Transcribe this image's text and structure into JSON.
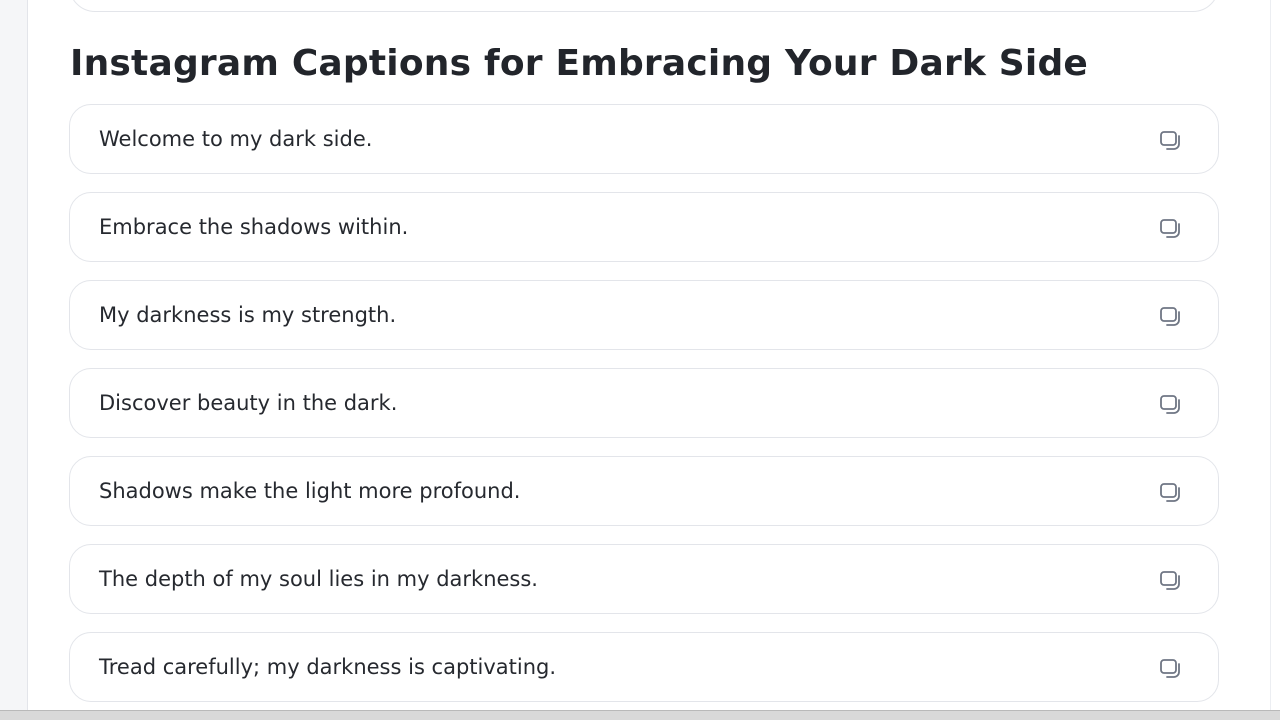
{
  "section": {
    "title": "Instagram Captions for Embracing Your Dark Side"
  },
  "captions": [
    {
      "text": "Welcome to my dark side.",
      "icon": "copy-icon"
    },
    {
      "text": "Embrace the shadows within.",
      "icon": "copy-icon"
    },
    {
      "text": "My darkness is my strength.",
      "icon": "copy-icon"
    },
    {
      "text": "Discover beauty in the dark.",
      "icon": "copy-icon"
    },
    {
      "text": "Shadows make the light more profound.",
      "icon": "copy-icon"
    },
    {
      "text": "The depth of my soul lies in my darkness.",
      "icon": "copy-icon"
    },
    {
      "text": "Tread carefully; my darkness is captivating.",
      "icon": "copy-icon"
    }
  ],
  "colors": {
    "text": "#26292f",
    "title": "#22252b",
    "border": "#e3e5ea",
    "icon": "#6f7684"
  }
}
